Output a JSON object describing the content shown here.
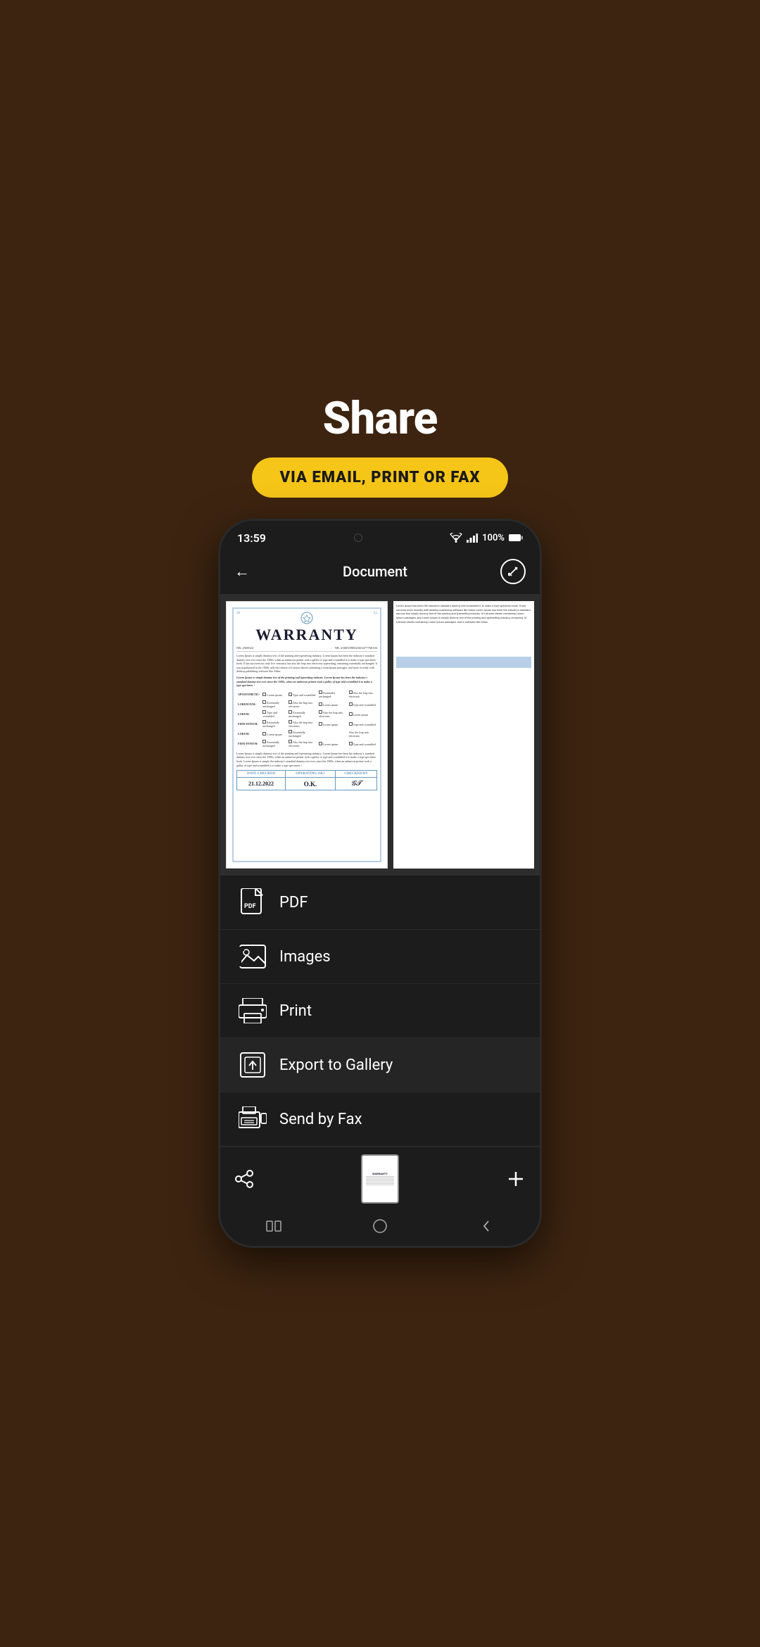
{
  "header": {
    "title": "Share",
    "badge": "VIA EMAIL, PRINT OR FAX"
  },
  "statusBar": {
    "time": "13:59",
    "battery": "100%",
    "signal": "WiFi"
  },
  "nav": {
    "title": "Document"
  },
  "warranty": {
    "year1": "20",
    "year2": "22",
    "title": "WARRANTY",
    "nr1": "NR.:2568322",
    "nr2": "NR.:25683590841665477768166",
    "dateChecked": "21.12.2022",
    "operatingOk": "O.K.",
    "checkedBy": "CHECKED BY",
    "dateLabel": "DATE CHECKED",
    "operatingLabel": "OPERATING OK?"
  },
  "menu": {
    "items": [
      {
        "id": "pdf",
        "label": "PDF"
      },
      {
        "id": "images",
        "label": "Images"
      },
      {
        "id": "print",
        "label": "Print"
      },
      {
        "id": "export",
        "label": "Export to Gallery"
      },
      {
        "id": "fax",
        "label": "Send by Fax"
      }
    ]
  },
  "colors": {
    "background": "#3d2410",
    "badge": "#f5c518",
    "phone_bg": "#1c1c1c",
    "menu_bg": "#1c1c1c",
    "text_white": "#ffffff",
    "text_dark": "#1a1a2e",
    "accent_blue": "#6699bb"
  }
}
